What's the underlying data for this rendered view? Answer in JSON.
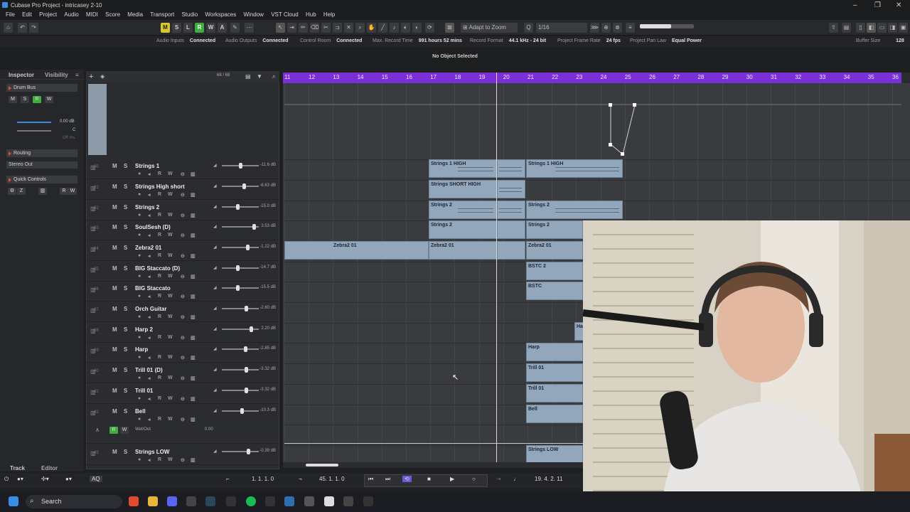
{
  "window": {
    "title": "Cubase Pro Project - intricasey 2-10"
  },
  "menu": [
    "File",
    "Edit",
    "Project",
    "Audio",
    "MIDI",
    "Score",
    "Media",
    "Transport",
    "Studio",
    "Workspaces",
    "Window",
    "VST Cloud",
    "Hub",
    "Help"
  ],
  "toolbar": {
    "m": "M",
    "s": "S",
    "l": "L",
    "r": "R",
    "w": "W",
    "a": "A",
    "snap_mode": "Adapt to Zoom",
    "quantize": "1/16"
  },
  "status": {
    "audio_inputs": "Audio Inputs",
    "audio_inputs_val": "Connected",
    "audio_outputs": "Audio Outputs",
    "audio_outputs_val": "Connected",
    "control_room": "Control Room",
    "control_room_val": "Connected",
    "max_rec": "Max. Record Time",
    "max_rec_val": "991 hours 52 mins",
    "rec_format": "Record Format",
    "rec_format_val": "44.1 kHz - 24 bit",
    "frame_rate": "Project Frame Rate",
    "frame_rate_val": "24 fps",
    "pan_law": "Project Pan Law",
    "pan_law_val": "Equal Power",
    "buffer": "Buffer Size",
    "buffer_val": "128"
  },
  "selection": "No Object Selected",
  "inspector": {
    "tab1": "Inspector",
    "tab2": "Visibility",
    "track": "Drum Bus",
    "vol": "0.00 dB",
    "pan": "C",
    "off": "Off ms",
    "routing": "Routing",
    "output": "Stereo Out",
    "quick": "Quick Controls"
  },
  "tracklist": {
    "count": "68 / 68"
  },
  "tracks": [
    {
      "num": "30",
      "name": "Strings 1",
      "vol": "-11.6 dB"
    },
    {
      "num": "31",
      "name": "Strings High short",
      "vol": "-6.63 dB"
    },
    {
      "num": "32",
      "name": "Strings 2",
      "vol": "-15.0 dB"
    },
    {
      "num": "33",
      "name": "SoulSesh (D)",
      "vol": "3.53 dB"
    },
    {
      "num": "34",
      "name": "Zebra2 01",
      "vol": "-1.22 dB"
    },
    {
      "num": "35",
      "name": "BIG Staccato (D)",
      "vol": "-14.7 dB"
    },
    {
      "num": "36",
      "name": "BIG Staccato",
      "vol": "-15.5 dB"
    },
    {
      "num": "37",
      "name": "Orch Guitar",
      "vol": "-2.60 dB"
    },
    {
      "num": "38",
      "name": "Harp 2",
      "vol": "2.20 dB"
    },
    {
      "num": "39",
      "name": "Harp",
      "vol": "-2.85 dB"
    },
    {
      "num": "40",
      "name": "Trill 01 (D)",
      "vol": "-3.32 dB"
    },
    {
      "num": "41",
      "name": "Trill 01",
      "vol": "-3.32 dB"
    },
    {
      "num": "42",
      "name": "Bell",
      "vol": "-10.3 dB"
    },
    {
      "num": "43",
      "name": "Strings LOW",
      "vol": "-0.39 dB"
    }
  ],
  "automation": {
    "param": "Wet/Out",
    "val": "0.00"
  },
  "ruler": [
    "11",
    "12",
    "13",
    "14",
    "15",
    "16",
    "17",
    "18",
    "19",
    "20",
    "21",
    "22",
    "23",
    "24",
    "25",
    "26",
    "27",
    "28",
    "29",
    "30",
    "31",
    "32",
    "33",
    "34",
    "35",
    "36"
  ],
  "events": {
    "s1h": "Strings 1 HIGH",
    "ssh": "Strings SHORT HIGH",
    "s2": "Strings 2",
    "z": "Zebra2 01",
    "bstc2": "BSTC 2",
    "bstc": "BSTC",
    "ha": "Ha",
    "harp": "Harp",
    "trill": "Trill 01",
    "bell": "Bell",
    "slow": "Strings LOW"
  },
  "bottom": {
    "track": "Track",
    "editor": "Editor",
    "aq": "AQ"
  },
  "transport": {
    "left": "1. 1. 1. 0",
    "right": "45. 1. 1. 0",
    "pos": "19. 4. 2. 11"
  },
  "taskbar": {
    "search": "Search"
  },
  "colors": {
    "ruler": "#7b2fd6",
    "event": "#93a7bc",
    "record": "#3fae3f",
    "mute": "#d8c630"
  }
}
